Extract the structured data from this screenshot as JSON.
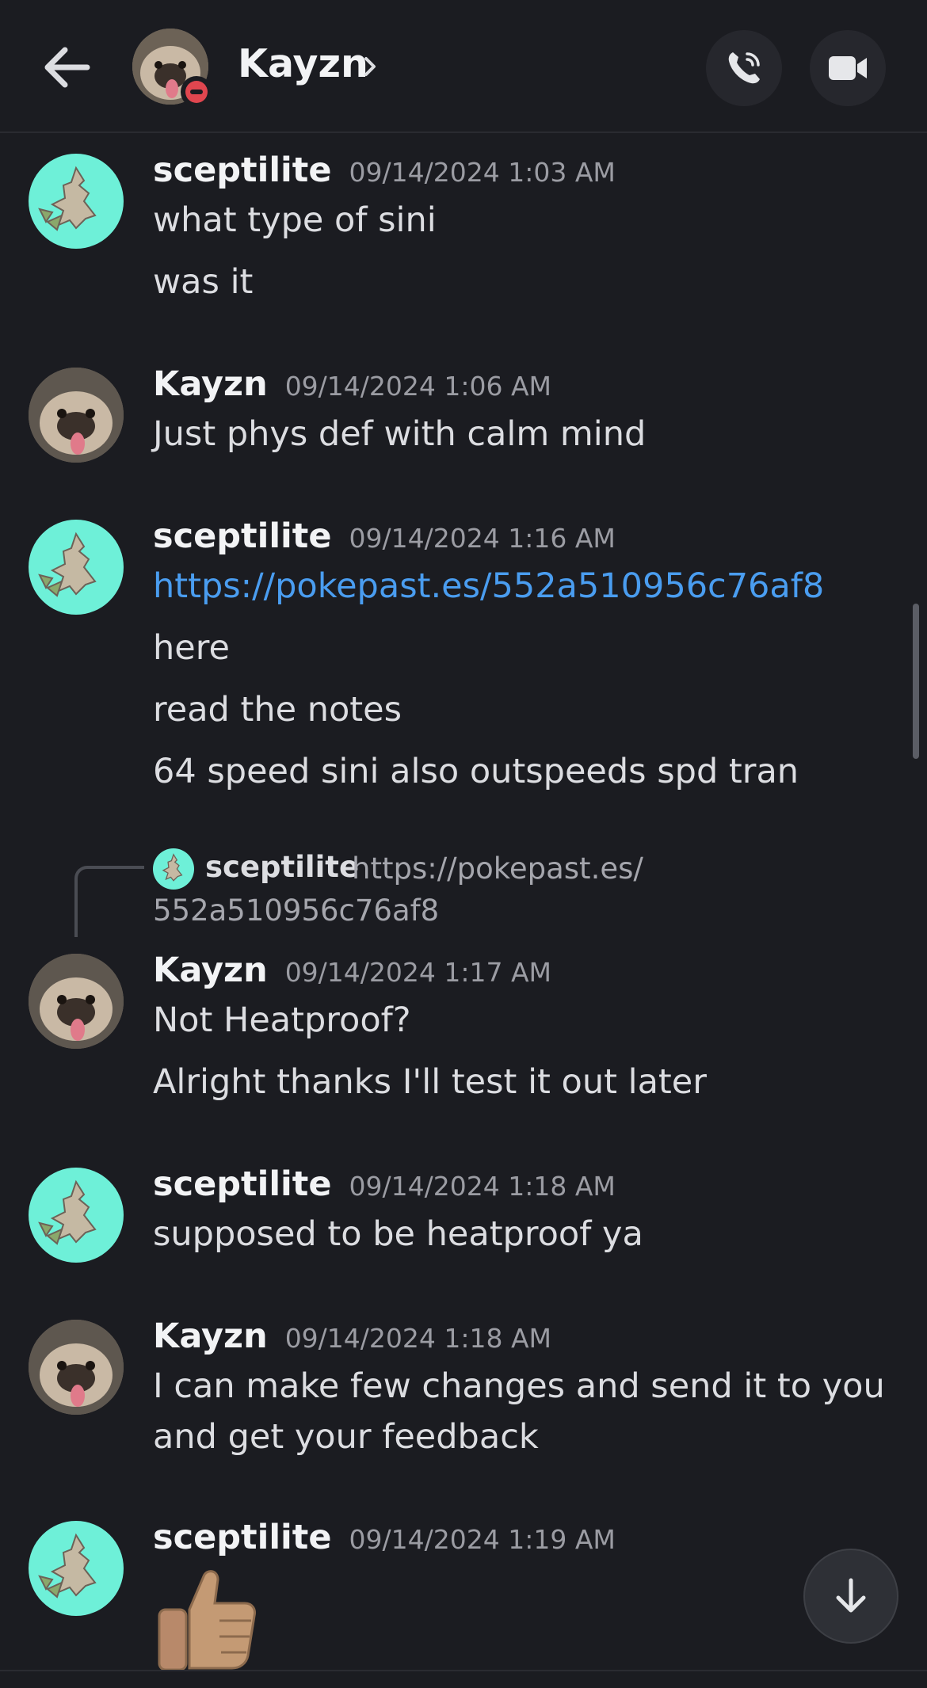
{
  "header": {
    "contact_name": "Kayzn"
  },
  "messages": [
    {
      "author": "sceptilite",
      "time": "09/14/2024 1:03 AM",
      "lines": [
        "what type of sini",
        "was it"
      ]
    },
    {
      "author": "Kayzn",
      "time": "09/14/2024 1:06 AM",
      "lines": [
        "Just phys def with calm mind"
      ]
    },
    {
      "author": "sceptilite",
      "time": "09/14/2024 1:16 AM",
      "link": "https://pokepast.es/552a510956c76af8",
      "lines": [
        "here",
        "read the notes",
        "64 speed sini also outspeeds spd tran"
      ]
    },
    {
      "reply": {
        "author": "sceptilite",
        "text_1": "https://pokepast.es/",
        "text_2": "552a510956c76af8"
      },
      "author": "Kayzn",
      "time": "09/14/2024 1:17 AM",
      "lines": [
        "Not Heatproof?",
        "Alright thanks I'll test it out later"
      ]
    },
    {
      "author": "sceptilite",
      "time": "09/14/2024 1:18 AM",
      "lines": [
        "supposed to be heatproof ya"
      ]
    },
    {
      "author": "Kayzn",
      "time": "09/14/2024 1:18 AM",
      "lines": [
        "I can make few changes and send it to you and get your feedback"
      ]
    },
    {
      "author": "sceptilite",
      "time": "09/14/2024 1:19 AM",
      "emoji": "thumbs-up"
    }
  ],
  "colors": {
    "background": "#1b1c21",
    "link": "#4a9df0",
    "scept_avatar_bg": "#6ef0d8",
    "dnd_status": "#e0464f"
  },
  "icons": [
    "arrow-left-icon",
    "chevron-right-icon",
    "phone-icon",
    "video-camera-icon",
    "arrow-down-icon",
    "thumbs-up-emoji"
  ]
}
